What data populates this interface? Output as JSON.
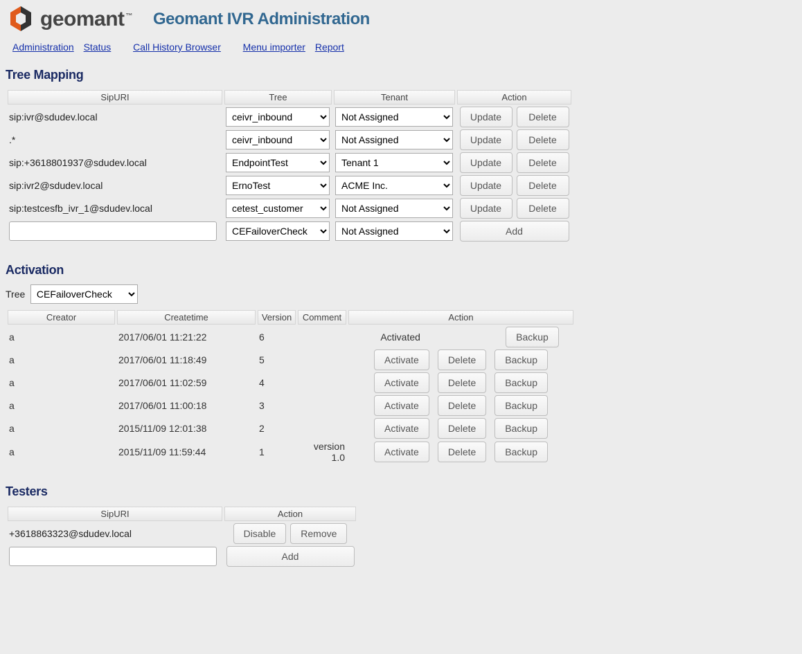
{
  "header": {
    "logo_text": "geomant",
    "page_title": "Geomant IVR Administration"
  },
  "nav": {
    "administration": "Administration",
    "status": "Status",
    "call_history": "Call History Browser",
    "menu_importer": "Menu importer",
    "report": "Report"
  },
  "tree_mapping": {
    "heading": "Tree Mapping",
    "col_sipuri": "SipURI",
    "col_tree": "Tree",
    "col_tenant": "Tenant",
    "col_action": "Action",
    "btn_update": "Update",
    "btn_delete": "Delete",
    "btn_add": "Add",
    "rows": [
      {
        "sipuri": "sip:ivr@sdudev.local",
        "tree": "ceivr_inbound",
        "tenant": "Not Assigned"
      },
      {
        "sipuri": ".*",
        "tree": "ceivr_inbound",
        "tenant": "Not Assigned"
      },
      {
        "sipuri": "sip:+3618801937@sdudev.local",
        "tree": "EndpointTest",
        "tenant": "Tenant 1"
      },
      {
        "sipuri": "sip:ivr2@sdudev.local",
        "tree": "ErnoTest",
        "tenant": "ACME Inc."
      },
      {
        "sipuri": "sip:testcesfb_ivr_1@sdudev.local",
        "tree": "cetest_customer",
        "tenant": "Not Assigned"
      }
    ],
    "new_row": {
      "tree": "CEFailoverCheck",
      "tenant": "Not Assigned"
    },
    "tree_options": [
      "ceivr_inbound",
      "EndpointTest",
      "ErnoTest",
      "cetest_customer",
      "CEFailoverCheck"
    ],
    "tenant_options": [
      "Not Assigned",
      "Tenant 1",
      "ACME Inc."
    ]
  },
  "activation": {
    "heading": "Activation",
    "label_tree": "Tree",
    "select_value": "CEFailoverCheck",
    "select_options": [
      "CEFailoverCheck",
      "ceivr_inbound",
      "EndpointTest",
      "ErnoTest",
      "cetest_customer"
    ],
    "col_creator": "Creator",
    "col_createtime": "Createtime",
    "col_version": "Version",
    "col_comment": "Comment",
    "col_action": "Action",
    "activated_text": "Activated",
    "btn_activate": "Activate",
    "btn_delete": "Delete",
    "btn_backup": "Backup",
    "rows": [
      {
        "creator": "a",
        "time": "2017/06/01 11:21:22",
        "version": "6",
        "comment": "",
        "activated": true
      },
      {
        "creator": "a",
        "time": "2017/06/01 11:18:49",
        "version": "5",
        "comment": "",
        "activated": false
      },
      {
        "creator": "a",
        "time": "2017/06/01 11:02:59",
        "version": "4",
        "comment": "",
        "activated": false
      },
      {
        "creator": "a",
        "time": "2017/06/01 11:00:18",
        "version": "3",
        "comment": "",
        "activated": false
      },
      {
        "creator": "a",
        "time": "2015/11/09 12:01:38",
        "version": "2",
        "comment": "",
        "activated": false
      },
      {
        "creator": "a",
        "time": "2015/11/09 11:59:44",
        "version": "1",
        "comment": "version 1.0",
        "activated": false
      }
    ]
  },
  "testers": {
    "heading": "Testers",
    "col_sipuri": "SipURI",
    "col_action": "Action",
    "btn_disable": "Disable",
    "btn_remove": "Remove",
    "btn_add": "Add",
    "rows": [
      {
        "sipuri": "+3618863323@sdudev.local"
      }
    ]
  }
}
